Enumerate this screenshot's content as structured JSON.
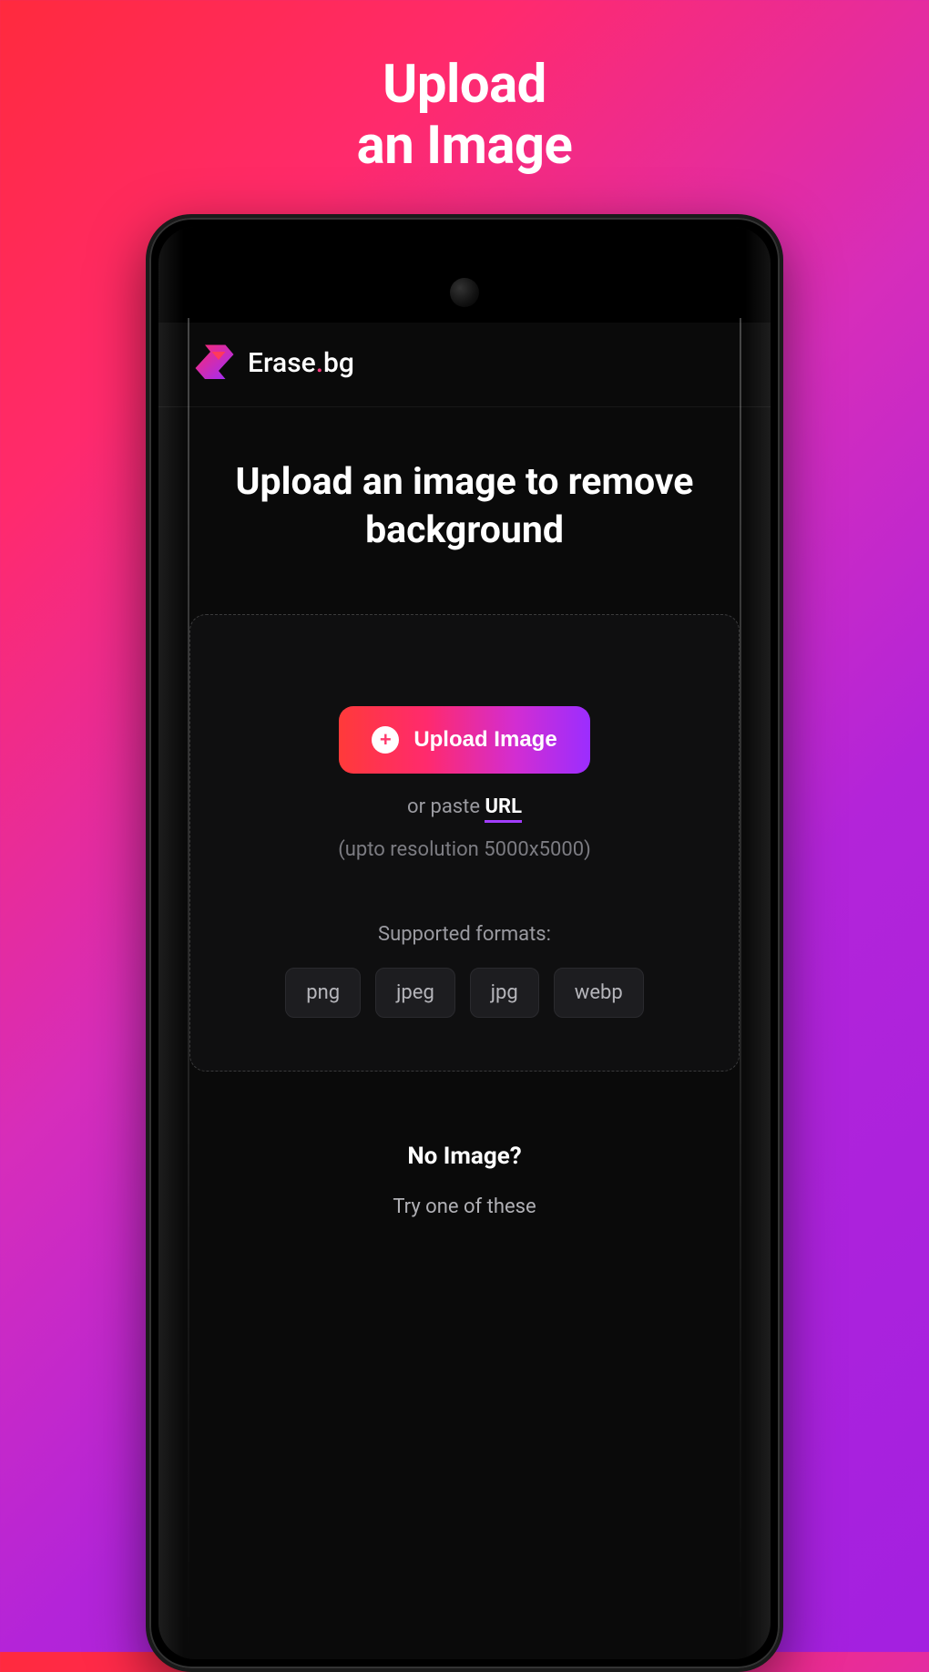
{
  "promo": {
    "line1": "Upload",
    "line2": "an Image"
  },
  "header": {
    "app_name_prefix": "Erase",
    "app_name_suffix": "bg"
  },
  "main": {
    "heading": "Upload an image to remove background",
    "upload_button_label": "Upload Image",
    "paste_prefix": "or paste ",
    "paste_url_label": "URL",
    "resolution_hint": "(upto resolution 5000x5000)",
    "formats_label": "Supported formats:",
    "formats": [
      "png",
      "jpeg",
      "jpg",
      "webp"
    ],
    "no_image_title": "No Image?",
    "try_text": "Try one of these"
  }
}
